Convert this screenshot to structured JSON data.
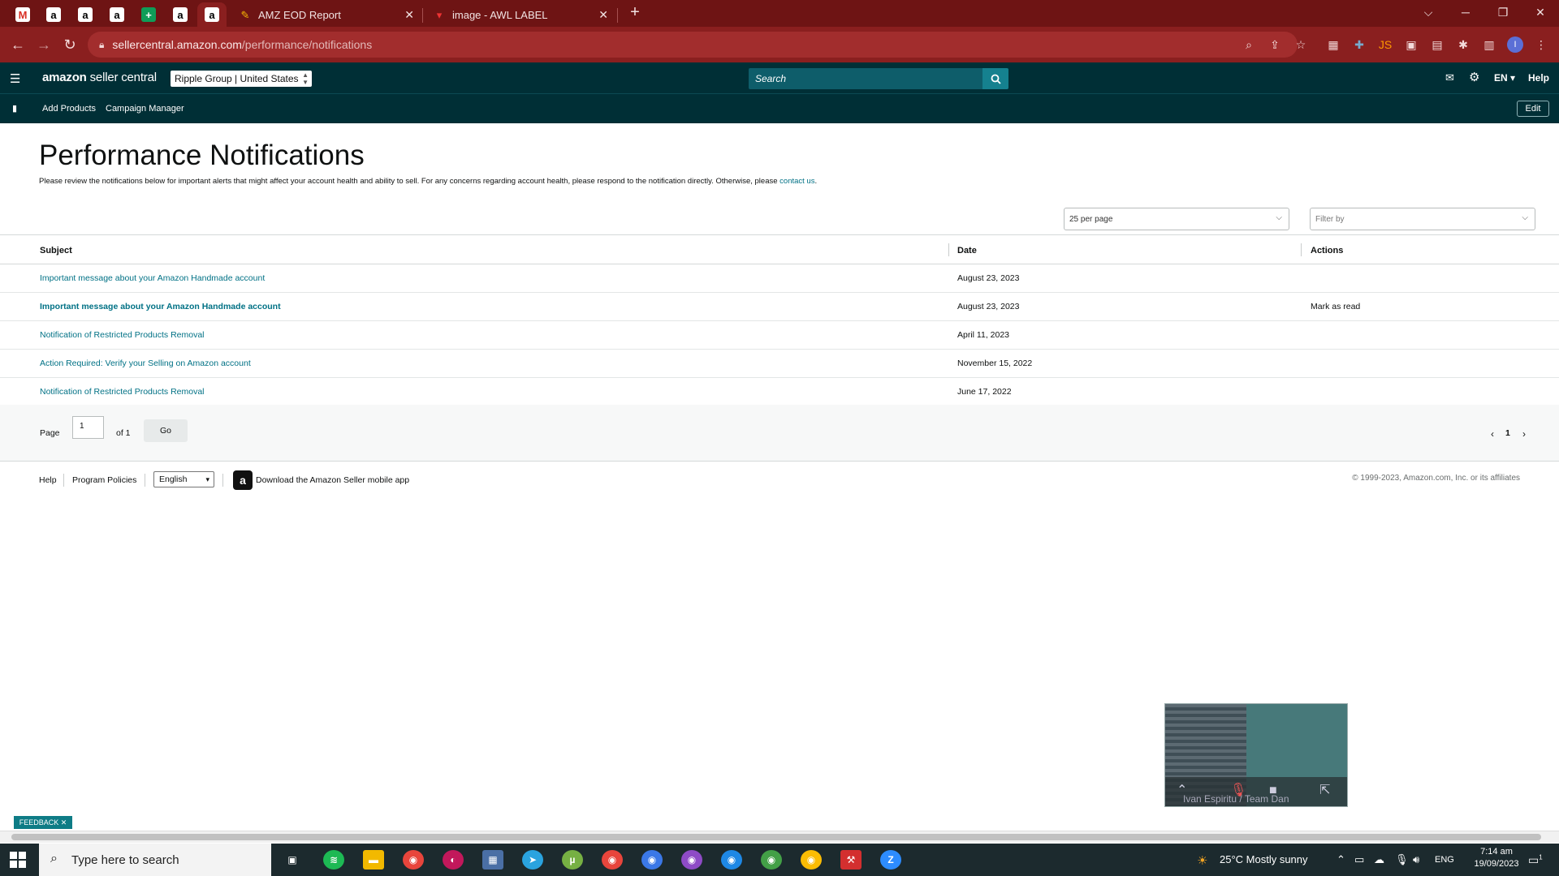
{
  "browser": {
    "pinned_tabs": [
      "M",
      "a",
      "a",
      "a",
      "+",
      "a",
      "a"
    ],
    "tabs": [
      {
        "title": "AMZ EOD Report"
      },
      {
        "title": "image - AWL LABEL"
      }
    ],
    "new_tab": "+",
    "url_domain": "sellercentral.amazon.com",
    "url_path": "/performance/notifications"
  },
  "header": {
    "logo_bold": "amazon",
    "logo_rest": " seller central",
    "account": "Ripple Group | United States",
    "search_placeholder": "Search",
    "lang": "EN",
    "help": "Help"
  },
  "subnav": {
    "links": [
      "Add Products",
      "Campaign Manager"
    ],
    "edit": "Edit"
  },
  "page": {
    "title": "Performance Notifications",
    "intro": "Please review the notifications below for important alerts that might affect your account health and ability to sell. For any concerns regarding account health, please respond to the notification directly. Otherwise, please ",
    "intro_link": "contact us",
    "intro_end": ".",
    "per_page": "25 per page",
    "filter": "Filter by"
  },
  "table": {
    "headers": {
      "subject": "Subject",
      "date": "Date",
      "actions": "Actions"
    },
    "rows": [
      {
        "subject": "Important message about your Amazon Handmade account",
        "date": "August 23, 2023",
        "action": "",
        "bold": false
      },
      {
        "subject": "Important message about your Amazon Handmade account",
        "date": "August 23, 2023",
        "action": "Mark as read",
        "bold": true
      },
      {
        "subject": "Notification of Restricted Products Removal",
        "date": "April 11, 2023",
        "action": "",
        "bold": false
      },
      {
        "subject": "Action Required: Verify your Selling on Amazon account",
        "date": "November 15, 2022",
        "action": "",
        "bold": false
      },
      {
        "subject": "Notification of Restricted Products Removal",
        "date": "June 17, 2022",
        "action": "",
        "bold": false
      }
    ]
  },
  "pager": {
    "page_label": "Page",
    "page_value": "1",
    "of_label": "of 1",
    "go": "Go",
    "current": "1"
  },
  "footer": {
    "help": "Help",
    "policies": "Program Policies",
    "language": "English",
    "app_text": "Download the Amazon Seller mobile app",
    "copyright": "© 1999-2023, Amazon.com, Inc. or its affiliates"
  },
  "video": {
    "caption": "Ivan Espiritu / Team Dan"
  },
  "feedback": "FEEDBACK",
  "taskbar": {
    "search_placeholder": "Type here to search",
    "weather": "25°C  Mostly sunny",
    "lang": "ENG",
    "time": "7:14 am",
    "date": "19/09/2023",
    "notif_count": "1"
  },
  "colors": {
    "chrome_frame": "#6e1414",
    "header_bg": "#002f36",
    "link": "#007185",
    "search_btn": "#15818f"
  }
}
